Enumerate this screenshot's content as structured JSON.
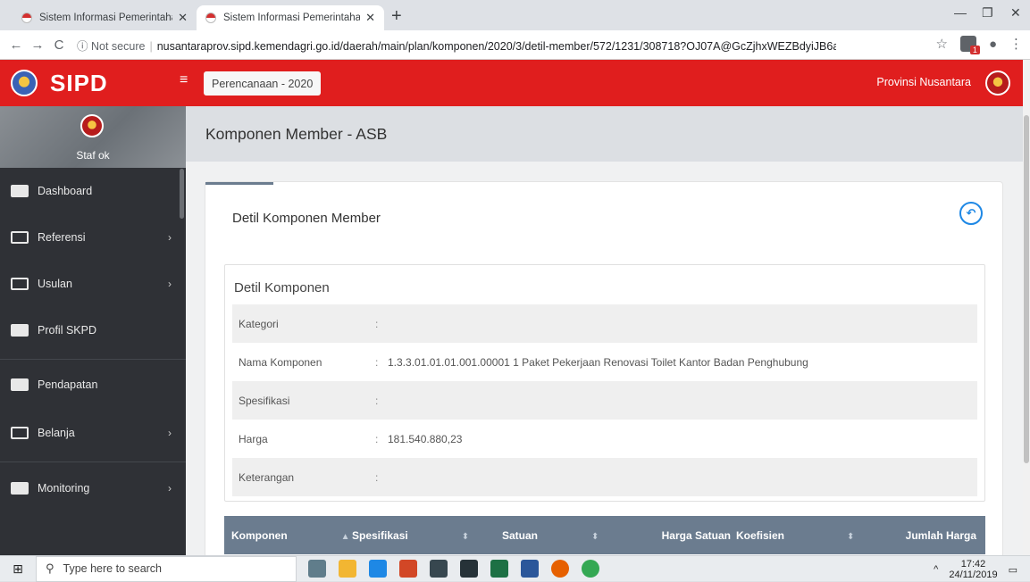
{
  "browser": {
    "tabs": [
      {
        "title": "Sistem Informasi Pemerintahan D"
      },
      {
        "title": "Sistem Informasi Pemerintahan D"
      }
    ],
    "url_security": "Not secure",
    "url": "nusantaraprov.sipd.kemendagri.go.id/daerah/main/plan/komponen/2020/3/detil-member/572/1231/308718?OJ07A@GcZjhxWEZBdyiJB6awUVA60txOm27s...",
    "extension_badge": "1"
  },
  "app": {
    "brand": "SIPD",
    "period": "Perencanaan - 2020",
    "province": "Provinsi Nusantara"
  },
  "sidebar": {
    "user": "Staf ok",
    "items": [
      {
        "label": "Dashboard",
        "chevron": ""
      },
      {
        "label": "Referensi",
        "chevron": "›"
      },
      {
        "label": "Usulan",
        "chevron": "›"
      },
      {
        "label": "Profil SKPD",
        "chevron": ""
      },
      {
        "label": "Pendapatan",
        "chevron": ""
      },
      {
        "label": "Belanja",
        "chevron": "›"
      },
      {
        "label": "Monitoring",
        "chevron": "›"
      }
    ]
  },
  "main": {
    "page_title": "Komponen Member - ASB",
    "card_title": "Detil Komponen Member",
    "detail_heading": "Detil Komponen",
    "details": [
      {
        "label": "Kategori",
        "value": ""
      },
      {
        "label": "Nama Komponen",
        "value": "1.3.3.01.01.01.001.00001 1 Paket Pekerjaan Renovasi Toilet Kantor Badan Penghubung"
      },
      {
        "label": "Spesifikasi",
        "value": ""
      },
      {
        "label": "Harga",
        "value": "181.540.880,23"
      },
      {
        "label": "Keterangan",
        "value": ""
      }
    ],
    "table_headers": [
      "Komponen",
      "Spesifikasi",
      "Satuan",
      "Harga Satuan",
      "Koefisien",
      "Jumlah Harga"
    ]
  },
  "taskbar": {
    "search_placeholder": "Type here to search",
    "time": "17:42",
    "date": "24/11/2019"
  }
}
